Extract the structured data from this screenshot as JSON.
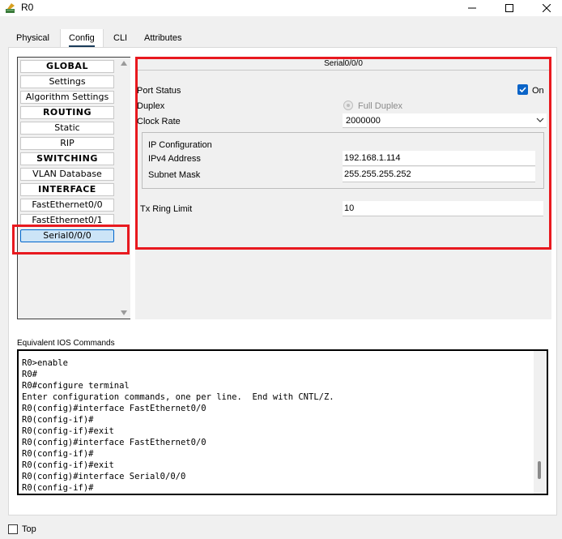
{
  "window": {
    "title": "R0",
    "icon": "router-icon",
    "controls": [
      "minimize-icon",
      "maximize-icon",
      "close-icon"
    ]
  },
  "tabs": [
    {
      "label": "Physical",
      "active": false
    },
    {
      "label": "Config",
      "active": true
    },
    {
      "label": "CLI",
      "active": false
    },
    {
      "label": "Attributes",
      "active": false
    }
  ],
  "left_list": {
    "items": [
      {
        "label": "GLOBAL",
        "kind": "section"
      },
      {
        "label": "Settings",
        "kind": "item"
      },
      {
        "label": "Algorithm Settings",
        "kind": "item"
      },
      {
        "label": "ROUTING",
        "kind": "section"
      },
      {
        "label": "Static",
        "kind": "item"
      },
      {
        "label": "RIP",
        "kind": "item"
      },
      {
        "label": "SWITCHING",
        "kind": "section"
      },
      {
        "label": "VLAN Database",
        "kind": "item"
      },
      {
        "label": "INTERFACE",
        "kind": "section"
      },
      {
        "label": "FastEthernet0/0",
        "kind": "item"
      },
      {
        "label": "FastEthernet0/1",
        "kind": "item"
      },
      {
        "label": "Serial0/0/0",
        "kind": "item",
        "selected": true
      }
    ]
  },
  "interface": {
    "header": "Serial0/0/0",
    "port_status_label": "Port Status",
    "on_label": "On",
    "on_checked": true,
    "duplex_label": "Duplex",
    "full_duplex_label": "Full Duplex",
    "clock_rate_label": "Clock Rate",
    "clock_rate_value": "2000000",
    "ip_config_title": "IP Configuration",
    "ipv4_label": "IPv4 Address",
    "ipv4_value": "192.168.1.114",
    "mask_label": "Subnet Mask",
    "mask_value": "255.255.255.252",
    "tx_ring_label": "Tx Ring Limit",
    "tx_ring_value": "10"
  },
  "ios": {
    "label": "Equivalent IOS Commands",
    "text": "R0>enable\nR0#\nR0#configure terminal\nEnter configuration commands, one per line.  End with CNTL/Z.\nR0(config)#interface FastEthernet0/0\nR0(config-if)#\nR0(config-if)#exit\nR0(config)#interface FastEthernet0/0\nR0(config-if)#\nR0(config-if)#exit\nR0(config)#interface Serial0/0/0\nR0(config-if)#"
  },
  "bottom": {
    "top_label": "Top",
    "top_checked": false
  },
  "colors": {
    "highlight": "#e8191f",
    "accent": "#0a64c8",
    "selected_bg": "#cce4f7"
  }
}
